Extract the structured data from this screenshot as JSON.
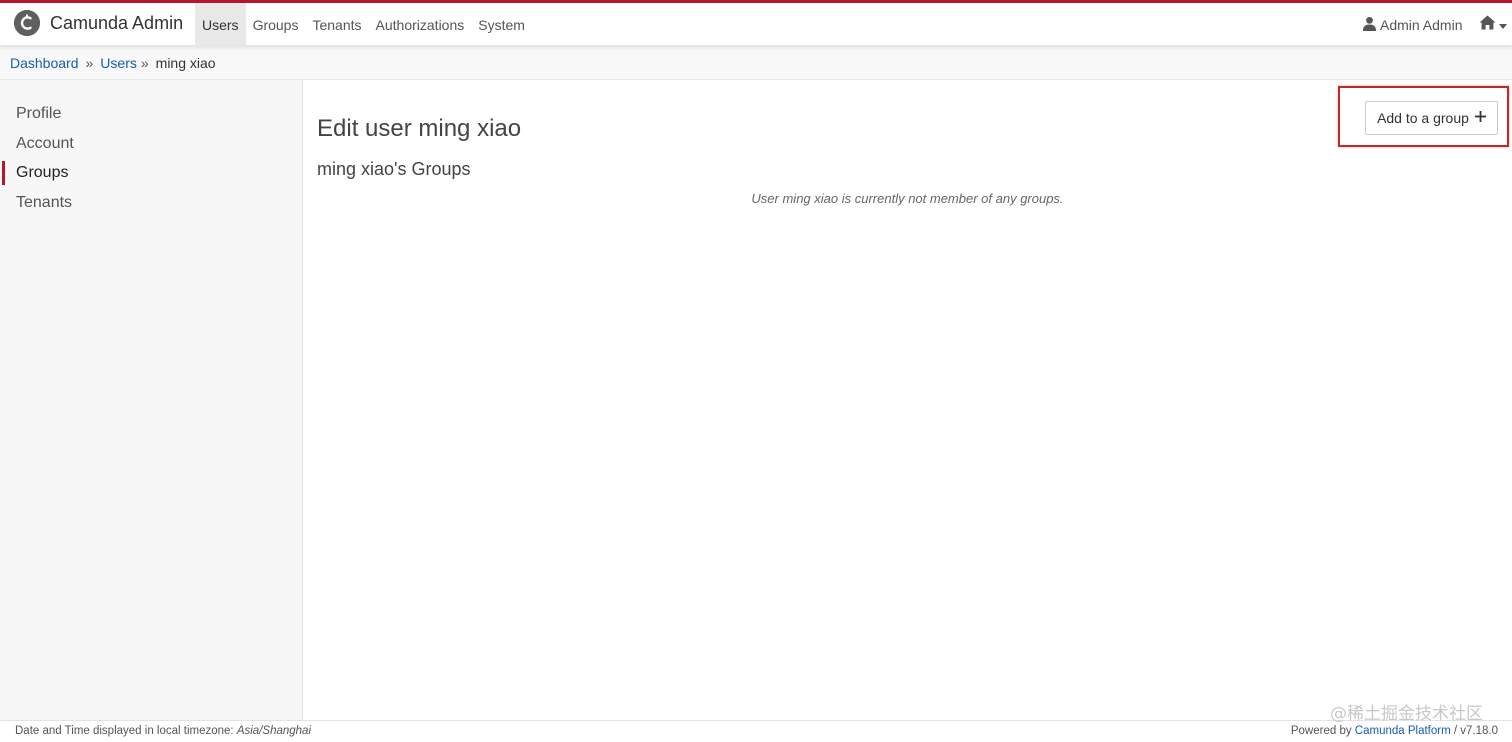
{
  "app": {
    "title": "Camunda Admin",
    "brand_color": "#b5152b",
    "logo_icon": "camunda-logo-icon"
  },
  "nav": {
    "items": [
      {
        "label": "Users",
        "active": true
      },
      {
        "label": "Groups",
        "active": false
      },
      {
        "label": "Tenants",
        "active": false
      },
      {
        "label": "Authorizations",
        "active": false
      },
      {
        "label": "System",
        "active": false
      }
    ],
    "user_label": "Admin Admin",
    "user_icon": "user-icon",
    "home_icon": "home-icon"
  },
  "breadcrumb": {
    "items": [
      "Dashboard",
      "Users"
    ],
    "separator": "»",
    "current": "ming xiao"
  },
  "sidebar": {
    "items": [
      {
        "label": "Profile",
        "active": false
      },
      {
        "label": "Account",
        "active": false
      },
      {
        "label": "Groups",
        "active": true
      },
      {
        "label": "Tenants",
        "active": false
      }
    ]
  },
  "main": {
    "page_title": "Edit user ming xiao",
    "section_title": "ming xiao's Groups",
    "empty_message": "User ming xiao is currently not member of any groups.",
    "add_button_label": "Add to a group",
    "add_button_icon": "plus-icon"
  },
  "footer": {
    "timezone_prefix": "Date and Time displayed in local timezone:",
    "timezone": "Asia/Shanghai",
    "powered_prefix": "Powered by",
    "powered_link": "Camunda Platform",
    "version": "/ v7.18.0"
  },
  "watermark": "@稀土掘金技术社区"
}
